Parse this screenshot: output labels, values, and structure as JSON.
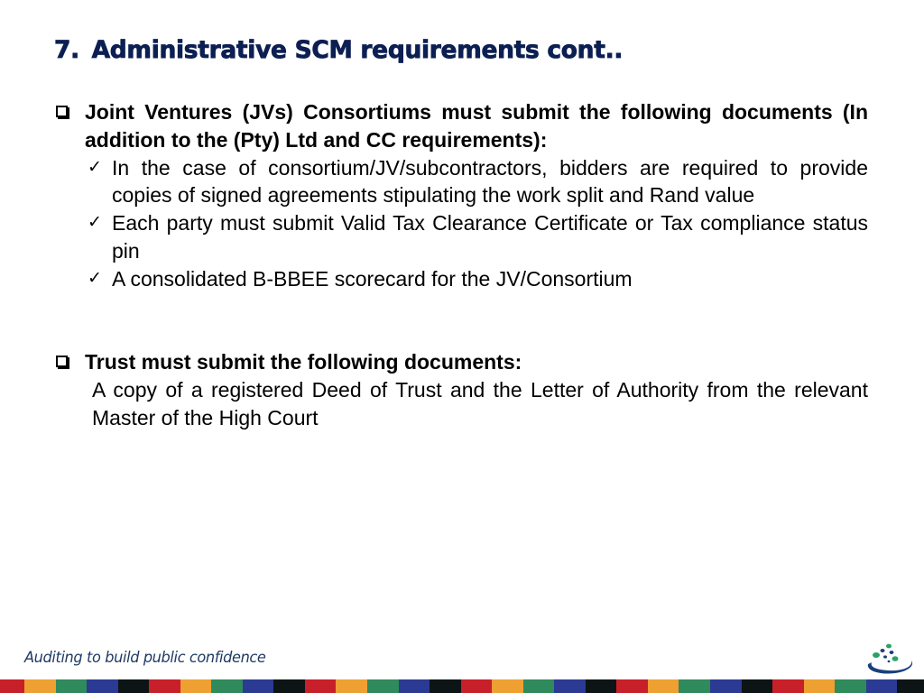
{
  "slide": {
    "title_number": "7.",
    "title_text": "Administrative SCM requirements cont..",
    "sections": [
      {
        "heading": "Joint Ventures (JVs) Consortiums must submit the following documents (In addition to the (Pty) Ltd and CC requirements):",
        "bullet_icon": "square-checkbox-icon",
        "items": [
          "In the case of consortium/JV/subcontractors, bidders are required to provide copies of signed agreements stipulating the work split and Rand value",
          "Each party must submit Valid Tax Clearance Certificate or Tax compliance status pin",
          "A consolidated B-BBEE scorecard for the JV/Consortium"
        ],
        "item_icon": "checkmark-icon",
        "item_glyph": "✓"
      },
      {
        "heading": "Trust must submit the following documents:",
        "bullet_icon": "square-checkbox-icon",
        "paragraph": "A copy of a registered Deed of Trust and the Letter of Authority from the relevant Master of the High Court"
      }
    ]
  },
  "footer": {
    "tagline": "Auditing to build public confidence",
    "logo_icon": "auditor-general-logo-icon",
    "stripe_colors": [
      "#c8202a",
      "#eea032",
      "#2f8a5c",
      "#2b3a93",
      "#0d1416"
    ]
  },
  "colors": {
    "title": "#0c1f52",
    "tagline": "#1f3a63"
  }
}
